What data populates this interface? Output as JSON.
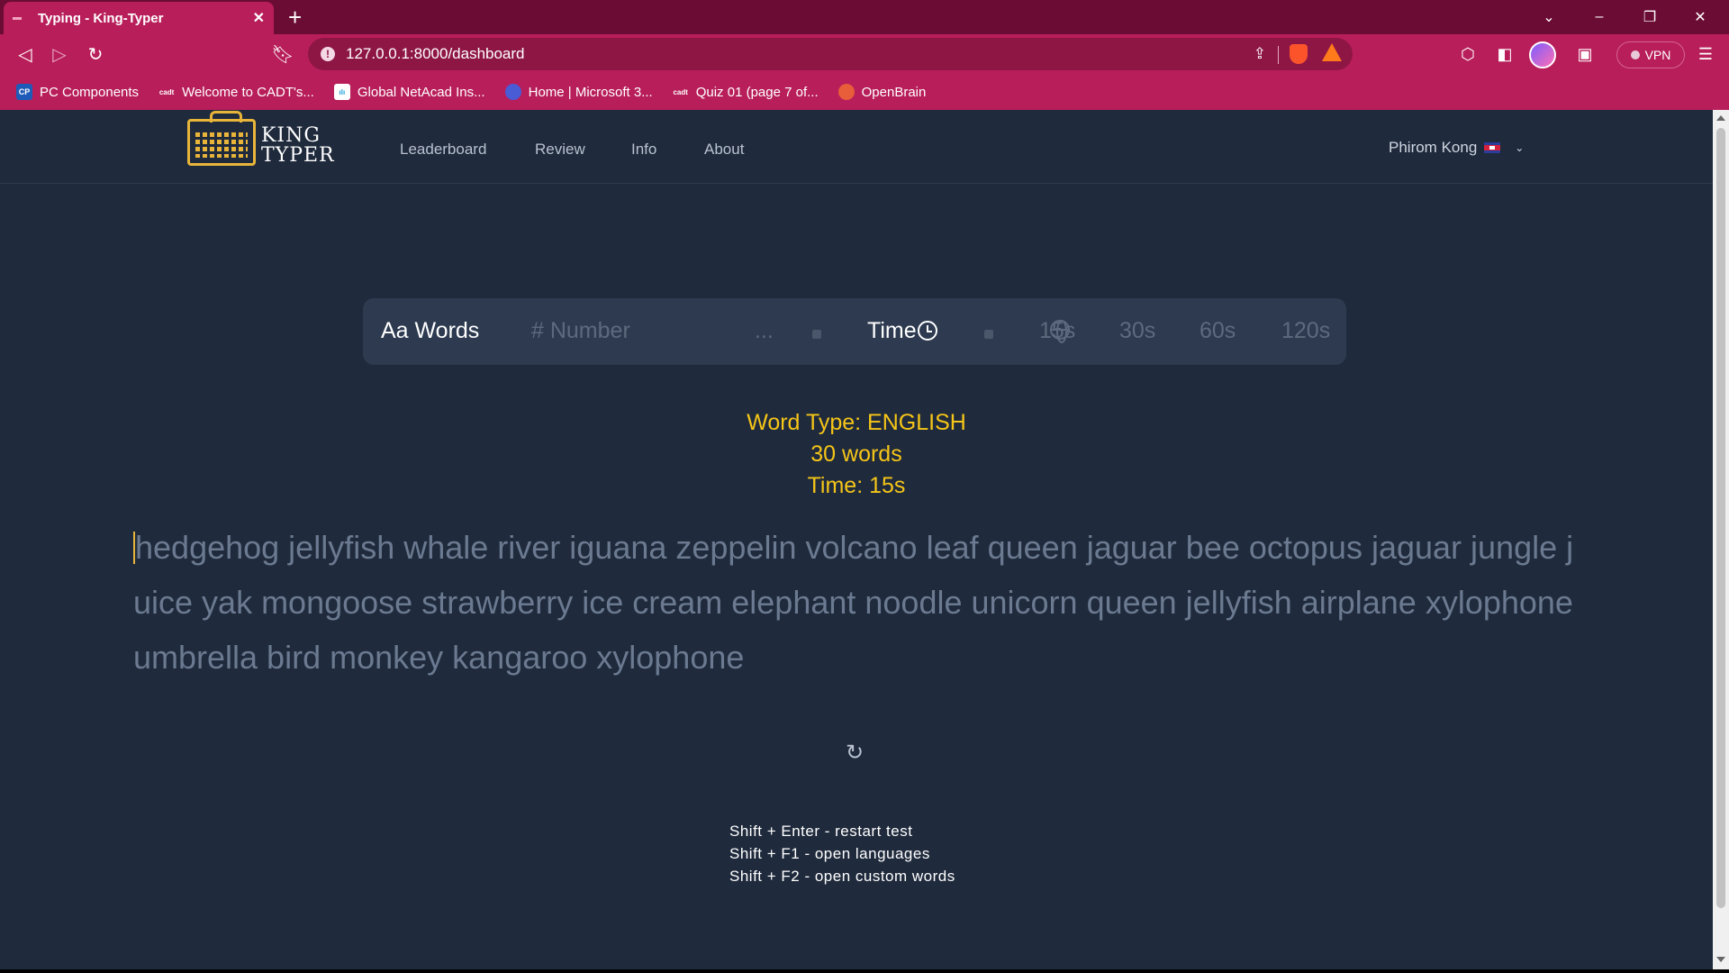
{
  "browser": {
    "tab_title": "Typing - King-Typer",
    "url": "127.0.0.1:8000/dashboard",
    "vpn_label": "VPN",
    "bookmarks": [
      {
        "label": "PC Components",
        "icon": "cp-icon",
        "color": "#1e5bb8"
      },
      {
        "label": "Welcome to CADT's...",
        "icon": "cadt-icon",
        "color": "#b81e5a"
      },
      {
        "label": "Global NetAcad Ins...",
        "icon": "cisco-icon",
        "color": "#ffffff"
      },
      {
        "label": "Home | Microsoft 3...",
        "icon": "microsoft365-icon",
        "color": "#4a5bd6"
      },
      {
        "label": "Quiz 01 (page 7 of...",
        "icon": "cadt-icon",
        "color": "#b81e5a"
      },
      {
        "label": "OpenBrain",
        "icon": "openbrain-icon",
        "color": "#e85d3a"
      }
    ]
  },
  "app": {
    "logo_line1": "KING",
    "logo_line2": "TYPER",
    "nav": [
      "Leaderboard",
      "Review",
      "Info",
      "About"
    ],
    "user_name": "Phirom Kong",
    "modes": {
      "words": "Aa Words",
      "number": "# Number",
      "ellipsis": "...",
      "time": "Time",
      "durations": [
        "15s",
        "30s",
        "60s",
        "120s"
      ]
    },
    "info": {
      "word_type": "Word Type: ENGLISH",
      "word_count": "30 words",
      "time": "Time: 15s"
    },
    "words_text": "hedgehog jellyfish whale river iguana zeppelin volcano leaf queen jaguar bee octopus jaguar jungle juice yak mongoose strawberry ice cream elephant noodle unicorn queen jellyfish airplane xylophone umbrella bird monkey kangaroo xylophone",
    "hints": [
      "Shift + Enter - restart test",
      "Shift + F1 - open languages",
      "Shift + F2 - open custom words"
    ],
    "colors": {
      "background": "#1f2a3c",
      "accent": "#f5c518",
      "text_dim": "#6b7a90"
    }
  }
}
